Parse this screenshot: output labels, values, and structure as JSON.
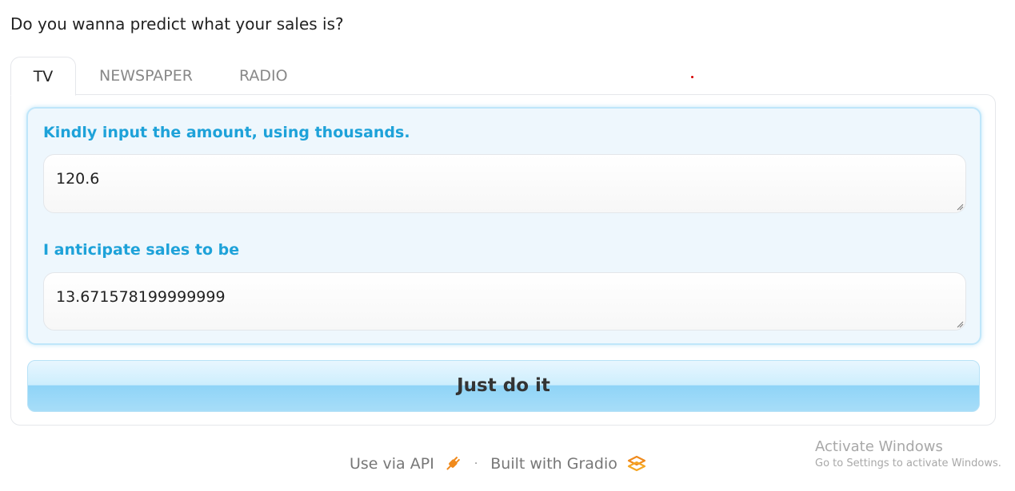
{
  "header": {
    "question": "Do you wanna predict what your sales is?"
  },
  "tabs": [
    {
      "label": "TV",
      "active": true
    },
    {
      "label": "NEWSPAPER",
      "active": false
    },
    {
      "label": "RADIO",
      "active": false
    }
  ],
  "form": {
    "input_label": "Kindly input the amount, using thousands.",
    "input_value": "120.6",
    "output_label": "I anticipate sales to be",
    "output_value": "13.671578199999999",
    "submit_label": "Just do it"
  },
  "footer": {
    "api_label": "Use via API",
    "separator": "·",
    "built_label": "Built with Gradio",
    "api_icon": "plug-icon",
    "gradio_icon": "gradio-logo-icon"
  },
  "watermark": {
    "title": "Activate Windows",
    "subtitle": "Go to Settings to activate Windows."
  },
  "colors": {
    "accent_label": "#1ea2d9",
    "form_background": "#eef7fd",
    "button_blue": "#8fd4f7",
    "api_icon_orange": "#f08a1c",
    "marker_red": "#d60000"
  }
}
